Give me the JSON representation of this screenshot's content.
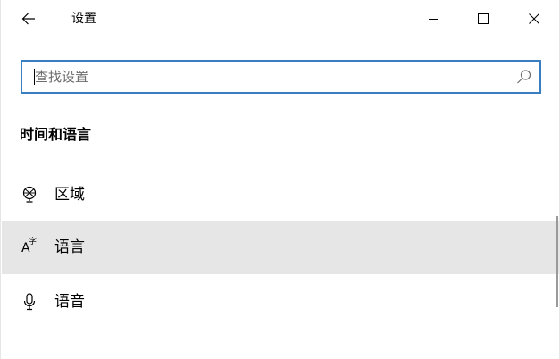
{
  "titlebar": {
    "title": "设置",
    "back_icon": "arrow-left-icon",
    "minimize_icon": "minimize-icon",
    "maximize_icon": "maximize-icon",
    "close_icon": "close-icon"
  },
  "search": {
    "placeholder": "查找设置",
    "value": "",
    "icon": "search-icon",
    "focus_color": "#3a7ec1"
  },
  "section": {
    "title": "时间和语言"
  },
  "nav": {
    "items": [
      {
        "label": "区域",
        "icon": "globe-region-icon",
        "selected": false
      },
      {
        "label": "语言",
        "icon": "language-icon",
        "selected": true,
        "icon_glyph_a": "A",
        "icon_glyph_zi": "字"
      },
      {
        "label": "语音",
        "icon": "microphone-icon",
        "selected": false
      }
    ]
  },
  "colors": {
    "selected_bg": "#e6e6e6",
    "accent": "#3a7ec1"
  }
}
